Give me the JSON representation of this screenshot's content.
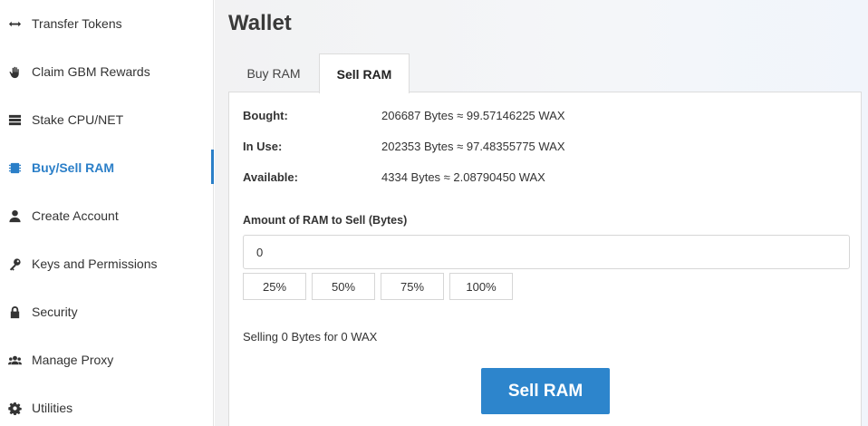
{
  "sidebar": {
    "items": [
      {
        "label": "Transfer Tokens",
        "icon": "arrows-horizontal-icon"
      },
      {
        "label": "Claim GBM Rewards",
        "icon": "hand-icon"
      },
      {
        "label": "Stake CPU/NET",
        "icon": "server-icon"
      },
      {
        "label": "Buy/Sell RAM",
        "icon": "memory-chip-icon",
        "active": true
      },
      {
        "label": "Create Account",
        "icon": "user-icon"
      },
      {
        "label": "Keys and Permissions",
        "icon": "key-icon"
      },
      {
        "label": "Security",
        "icon": "lock-icon"
      },
      {
        "label": "Manage Proxy",
        "icon": "users-icon"
      },
      {
        "label": "Utilities",
        "icon": "gear-icon"
      }
    ]
  },
  "main": {
    "title": "Wallet",
    "tabs": [
      {
        "label": "Buy RAM",
        "active": false
      },
      {
        "label": "Sell RAM",
        "active": true
      }
    ],
    "stats": [
      {
        "label": "Bought:",
        "value": "206687 Bytes ≈ 99.57146225 WAX"
      },
      {
        "label": "In Use:",
        "value": "202353 Bytes ≈ 97.48355775 WAX"
      },
      {
        "label": "Available:",
        "value": "4334 Bytes ≈ 2.08790450 WAX"
      }
    ],
    "amount_label": "Amount of RAM to Sell (Bytes)",
    "amount_value": "0",
    "percent_buttons": [
      "25%",
      "50%",
      "75%",
      "100%"
    ],
    "summary": "Selling 0 Bytes for 0 WAX",
    "submit_label": "Sell RAM"
  },
  "colors": {
    "accent": "#2b7fc8",
    "button": "#2d85cc"
  }
}
